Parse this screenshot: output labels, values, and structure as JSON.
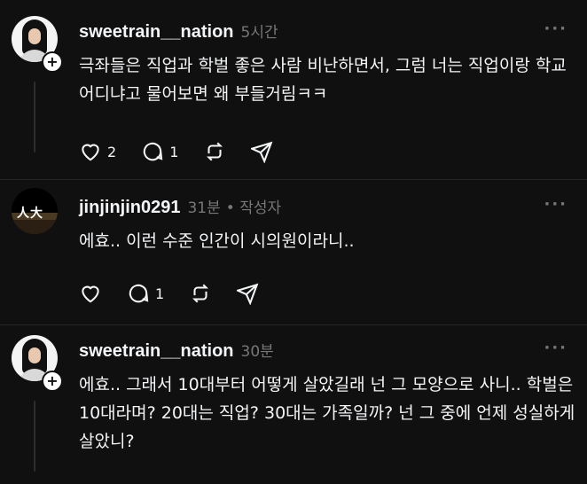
{
  "posts": [
    {
      "username": "sweetrain__nation",
      "time": "5시간",
      "text": "극좌들은 직업과 학벌 좋은 사람 비난하면서, 그럼 너는 직업이랑 학교 어디냐고 물어보면 왜 부들거림ㅋㅋ",
      "likes": "2",
      "replies": "1",
      "follow_symbol": "+",
      "more": "···"
    },
    {
      "username": "jinjinjin0291",
      "time": "31분",
      "author_tag": "• 작성자",
      "avatar_text": "人大",
      "text": "에효.. 이런 수준 인간이 시의원이라니..",
      "likes": "",
      "replies": "1",
      "more": "···"
    },
    {
      "username": "sweetrain__nation",
      "time": "30분",
      "text": "에효.. 그래서 10대부터 어떻게 살았길래 넌 그 모양으로 사니.. 학벌은 10대라며? 20대는 직업? 30대는 가족일까? 넌 그 중에 언제 성실하게 살았니?",
      "follow_symbol": "+",
      "more": "···"
    }
  ],
  "icons": [
    "heart-icon",
    "comment-icon",
    "repost-icon",
    "share-icon",
    "plus-icon",
    "more-icon"
  ]
}
